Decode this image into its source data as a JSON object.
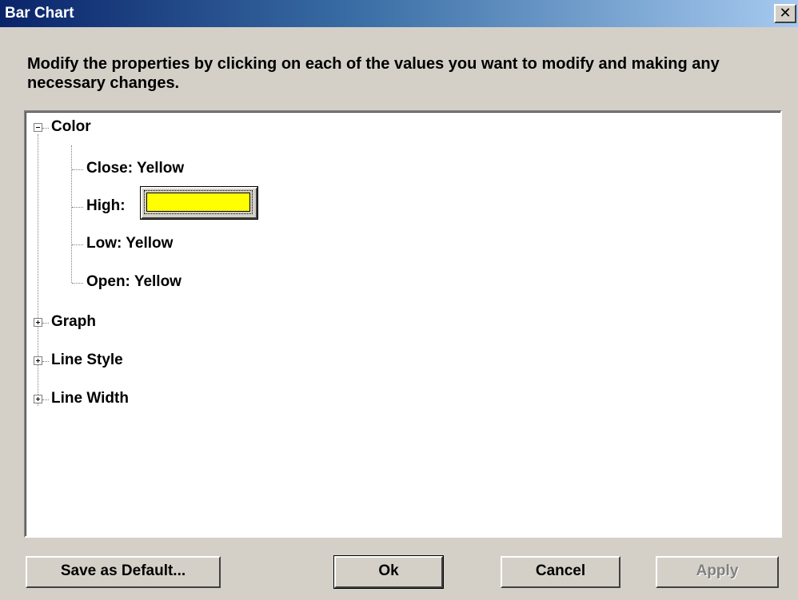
{
  "window": {
    "title": "Bar Chart",
    "close_glyph": "✕"
  },
  "instructions": "Modify the properties by clicking on each of the values you want to modify and making any necessary changes.",
  "tree": {
    "color": {
      "label": "Color",
      "expanded": true,
      "children": {
        "close": "Close: Yellow",
        "high_label": "High:",
        "high_value_color": "#ffff00",
        "low": "Low: Yellow",
        "open": "Open: Yellow"
      }
    },
    "graph": {
      "label": "Graph",
      "expanded": false
    },
    "line_style": {
      "label": "Line Style",
      "expanded": false
    },
    "line_width": {
      "label": "Line Width",
      "expanded": false
    }
  },
  "buttons": {
    "save_default": "Save as Default...",
    "ok": "Ok",
    "cancel": "Cancel",
    "apply": "Apply"
  }
}
